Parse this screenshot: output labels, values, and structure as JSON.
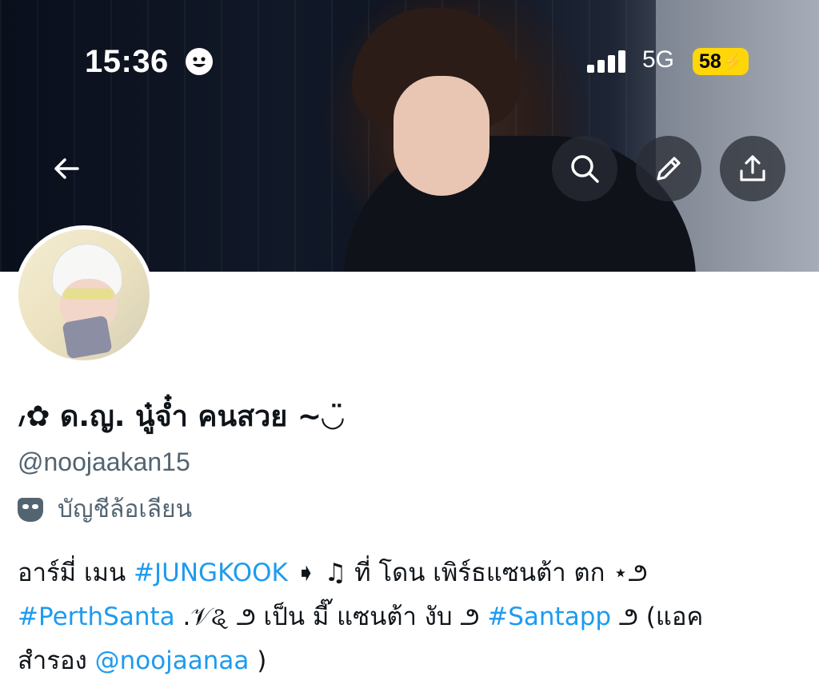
{
  "status_bar": {
    "time": "15:36",
    "network": "5G",
    "battery": "58"
  },
  "profile": {
    "display_name": "៸✿ ด.ญ. นู๋จ๋ำ คนสวย ~◡̈",
    "handle": "@noojaakan15",
    "parody_label": "บัญชีล้อเลียน",
    "bio": {
      "line1": {
        "t1": "อาร์มี่ เมน ",
        "link1": "#JUNGKOOK",
        "t2": " ➧ ♫ ที่ โดน เพิร์ธแซนต้า ตก ⋆౨"
      },
      "line2": {
        "link1": "#PerthSanta",
        "t1": " .𝒱ୡ ౨ เป็น มี๊ แซนต้า งับ ౨ ",
        "link2": "#Santapp",
        "t2": " ౨ (แอค"
      },
      "line3": {
        "t1": "สำรอง ",
        "link1": "@noojaanaa",
        "t2": " )"
      }
    }
  },
  "icons": {
    "back": "arrow-left-icon",
    "search": "search-icon",
    "edit": "pencil-icon",
    "share": "share-icon",
    "parody": "theater-mask-icon"
  },
  "colors": {
    "link": "#1d9bf0",
    "secondary_text": "#536471",
    "battery": "#ffd60a"
  }
}
